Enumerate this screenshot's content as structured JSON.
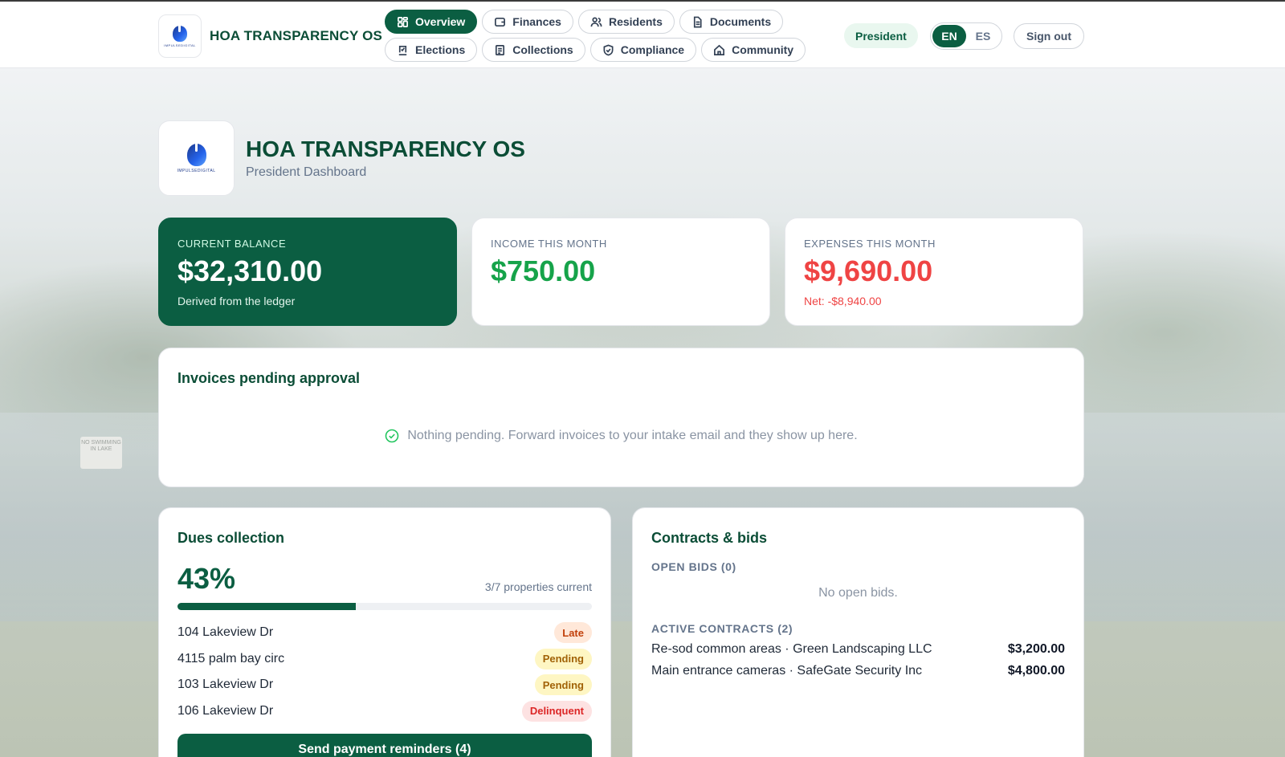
{
  "header": {
    "brand_name": "HOA TRANSPARENCY OS",
    "logo_text": "IMPULSEDIGITAL",
    "nav_row1": [
      {
        "label": "Overview",
        "icon": "grid-icon",
        "active": true
      },
      {
        "label": "Finances",
        "icon": "wallet-icon",
        "active": false
      },
      {
        "label": "Residents",
        "icon": "users-icon",
        "active": false
      },
      {
        "label": "Documents",
        "icon": "document-icon",
        "active": false
      }
    ],
    "nav_row2": [
      {
        "label": "Elections",
        "icon": "ballot-icon",
        "active": false
      },
      {
        "label": "Collections",
        "icon": "clipboard-icon",
        "active": false
      },
      {
        "label": "Compliance",
        "icon": "shield-icon",
        "active": false
      },
      {
        "label": "Community",
        "icon": "home-icon",
        "active": false
      }
    ],
    "role": "President",
    "lang_en": "EN",
    "lang_es": "ES",
    "signout": "Sign out"
  },
  "hero": {
    "title": "HOA TRANSPARENCY OS",
    "subtitle": "President Dashboard",
    "logo_text": "IMPULSEDIGITAL"
  },
  "stats": {
    "balance": {
      "label": "CURRENT BALANCE",
      "value": "$32,310.00",
      "note": "Derived from the ledger"
    },
    "income": {
      "label": "INCOME THIS MONTH",
      "value": "$750.00"
    },
    "expenses": {
      "label": "EXPENSES THIS MONTH",
      "value": "$9,690.00",
      "note": "Net: -$8,940.00"
    }
  },
  "invoices": {
    "title": "Invoices pending approval",
    "empty_text": "Nothing pending. Forward invoices to your intake email and they show up here."
  },
  "dues": {
    "title": "Dues collection",
    "percent": "43%",
    "progress_fraction": 0.43,
    "current_text": "3/7 properties current",
    "properties": [
      {
        "address": "104 Lakeview Dr",
        "status": "Late"
      },
      {
        "address": "4115 palm bay circ",
        "status": "Pending"
      },
      {
        "address": "103 Lakeview Dr",
        "status": "Pending"
      },
      {
        "address": "106 Lakeview Dr",
        "status": "Delinquent"
      }
    ],
    "reminder_button": "Send payment reminders (4)"
  },
  "contracts": {
    "title": "Contracts & bids",
    "open_bids_label": "OPEN BIDS (0)",
    "no_bids": "No open bids.",
    "active_label": "ACTIVE CONTRACTS (2)",
    "items": [
      {
        "desc": "Re-sod common areas · Green Landscaping LLC",
        "amount": "$3,200.00"
      },
      {
        "desc": "Main entrance cameras · SafeGate Security Inc",
        "amount": "$4,800.00"
      }
    ]
  },
  "colors": {
    "primary": "#0b5e42",
    "income": "#16a34a",
    "expense": "#ef4444"
  },
  "background_sign": "NO SWIMMING IN LAKE"
}
